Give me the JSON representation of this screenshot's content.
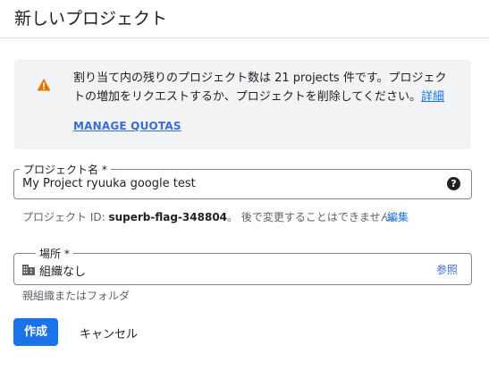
{
  "page": {
    "title": "新しいプロジェクト"
  },
  "notice": {
    "message": "割り当て内の残りのプロジェクト数は 21 projects 件です。プロジェクトの増加をリクエストするか、プロジェクトを削除してください。",
    "details_link": "詳細",
    "manage_quotas": "MANAGE QUOTAS",
    "icon": "warning-icon",
    "icon_color": "#e37400"
  },
  "project_name": {
    "label": "プロジェクト名 *",
    "value": "My Project ryuuka google test",
    "help_icon": "help-icon"
  },
  "project_id": {
    "prefix": "プロジェクト ID: ",
    "id": "superb-flag-348804",
    "suffix": "。 後で変更することはできません。",
    "edit_label": "編集"
  },
  "location": {
    "label": "場所 *",
    "value": "組織なし",
    "browse_label": "参照",
    "hint": "親組織またはフォルダ",
    "icon": "building-icon"
  },
  "actions": {
    "create_label": "作成",
    "cancel_label": "キャンセル"
  },
  "colors": {
    "primary": "#1a73e8",
    "notice_bg": "#f1f3f4",
    "border": "#80868b"
  }
}
